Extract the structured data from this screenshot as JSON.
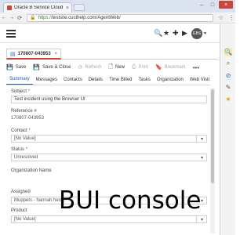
{
  "browser": {
    "tab_title": "Oracle B Service Cloud",
    "tab_close": "×",
    "url_scheme": "https://",
    "url_rest": "testsite.custhelp.com/AgentWeb/",
    "window_controls": {
      "minimize": "–",
      "maximize": "□",
      "close": "×"
    }
  },
  "header": {
    "user_initials": "GBS"
  },
  "record_tab": {
    "id": "170807-043953",
    "close": "×"
  },
  "toolbar": {
    "save": "Save",
    "save_close": "Save & Close",
    "refresh": "Refresh",
    "new": "New",
    "print": "Print",
    "bookmark": "Bookmark",
    "more": "•••"
  },
  "subtabs": [
    "Summary",
    "Messages",
    "Contacts",
    "Details",
    "Time Billed",
    "Tasks",
    "Organization",
    "Web Visit"
  ],
  "form": {
    "subject_label": "Subject",
    "subject_value": "Test incident using the Browser UI",
    "reference_label": "Reference #",
    "reference_value": "170807-043953",
    "contact_label": "Contact",
    "contact_value": "[No Value]",
    "status_label": "Status",
    "status_value": "Unresolved",
    "organization_label": "Organization Name",
    "assigned_label": "Assigned",
    "assigned_value": "Muppets - hannah hen...",
    "product_label": "Product",
    "product_value": "[No Value]"
  },
  "overlay_caption": "BUI console",
  "colors": {
    "accent": "#c74634",
    "link_blue": "#1f5aa6",
    "required_red": "#c74634"
  },
  "icons": {
    "side_panel": [
      "magnifier-icon",
      "search-icon",
      "tag-icon",
      "link-icon",
      "star-icon"
    ]
  }
}
